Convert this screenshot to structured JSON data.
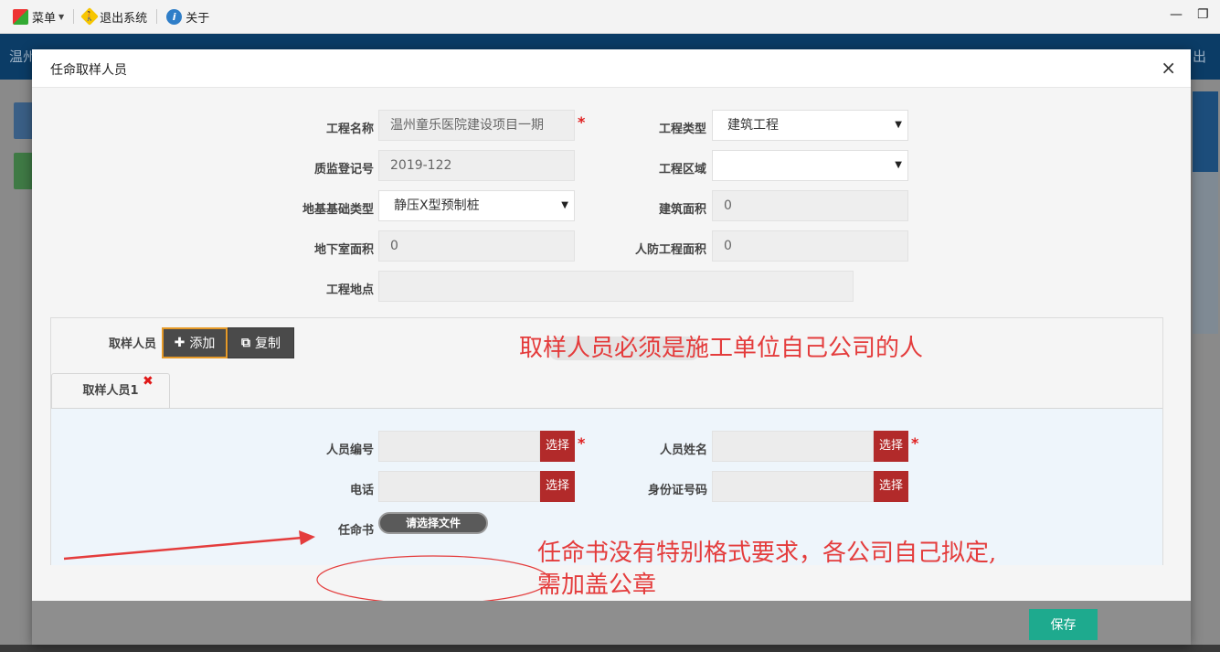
{
  "menubar": {
    "items": [
      {
        "label": "菜单",
        "icon": "windows-flag-icon"
      },
      {
        "label": "退出系统",
        "icon": "exit-walker-icon"
      },
      {
        "label": "关于",
        "icon": "info-icon"
      }
    ]
  },
  "background": {
    "header_left": "温州",
    "header_right": "出"
  },
  "modal": {
    "title": "任命取样人员",
    "close_glyph": "×",
    "footer": {
      "save_label": "保存"
    }
  },
  "project_form": {
    "project_name": {
      "label": "工程名称",
      "value": "温州童乐医院建设项目一期",
      "required": true
    },
    "project_type": {
      "label": "工程类型",
      "value": "建筑工程"
    },
    "registration_no": {
      "label": "质监登记号",
      "value": "2019-122"
    },
    "project_area": {
      "label": "工程区域",
      "value": ""
    },
    "foundation_type": {
      "label": "地基基础类型",
      "value": "静压X型预制桩"
    },
    "building_area": {
      "label": "建筑面积",
      "value": "0"
    },
    "basement_area": {
      "label": "地下室面积",
      "value": "0"
    },
    "civil_defense_area": {
      "label": "人防工程面积",
      "value": "0"
    },
    "project_location": {
      "label": "工程地点",
      "value": ""
    }
  },
  "sampling": {
    "label": "取样人员",
    "add_label": "添加",
    "copy_label": "复制",
    "tabs": [
      {
        "label": "取样人员1"
      }
    ],
    "tab_close_glyph": "✖",
    "fields": {
      "person_no": {
        "label": "人员编号",
        "value": "",
        "pick_label": "选择",
        "required": true
      },
      "person_name": {
        "label": "人员姓名",
        "value": "",
        "pick_label": "选择",
        "required": true
      },
      "phone": {
        "label": "电话",
        "value": "",
        "pick_label": "选择"
      },
      "id_no": {
        "label": "身份证号码",
        "value": "",
        "pick_label": "选择"
      },
      "appointment": {
        "label": "任命书",
        "button_label": "请选择文件"
      }
    }
  },
  "annotations": {
    "note_1": "取样人员必须是施工单位自己公司的人",
    "note_2_line1": "任命书没有特别格式要求，各公司自己拟定,",
    "note_2_line2": "需加盖公章",
    "color": "#e43c3c"
  },
  "colors": {
    "save_button": "#1eaa8e",
    "pick_button": "#b22a2a",
    "required": "#e02020",
    "add_button_border": "#e69a28"
  }
}
